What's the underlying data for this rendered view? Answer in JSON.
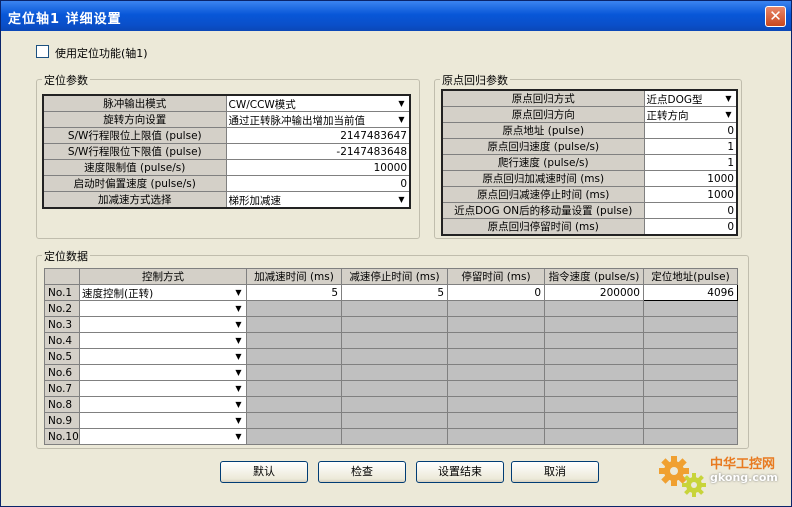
{
  "window": {
    "title": "定位轴1 详细设置",
    "close_label": "✕"
  },
  "enable": {
    "label": "使用定位功能(轴1)",
    "checked": false
  },
  "positioning_params": {
    "title": "定位参数",
    "rows": [
      {
        "label": "脉冲输出模式",
        "type": "select",
        "value": "CW/CCW模式"
      },
      {
        "label": "旋转方向设置",
        "type": "select",
        "value": "通过正转脉冲输出增加当前值"
      },
      {
        "label": "S/W行程限位上限值 (pulse)",
        "type": "number",
        "value": "2147483647"
      },
      {
        "label": "S/W行程限位下限值 (pulse)",
        "type": "number",
        "value": "-2147483648"
      },
      {
        "label": "速度限制值 (pulse/s)",
        "type": "number",
        "value": "10000"
      },
      {
        "label": "启动时偏置速度 (pulse/s)",
        "type": "number",
        "value": "0"
      },
      {
        "label": "加减速方式选择",
        "type": "select",
        "value": "梯形加减速"
      }
    ]
  },
  "origin_params": {
    "title": "原点回归参数",
    "rows": [
      {
        "label": "原点回归方式",
        "type": "select",
        "value": "近点DOG型"
      },
      {
        "label": "原点回归方向",
        "type": "select",
        "value": "正转方向"
      },
      {
        "label": "原点地址 (pulse)",
        "type": "number",
        "value": "0"
      },
      {
        "label": "原点回归速度 (pulse/s)",
        "type": "number",
        "value": "1"
      },
      {
        "label": "爬行速度 (pulse/s)",
        "type": "number",
        "value": "1"
      },
      {
        "label": "原点回归加减速时间 (ms)",
        "type": "number",
        "value": "1000"
      },
      {
        "label": "原点回归减速停止时间 (ms)",
        "type": "number",
        "value": "1000"
      },
      {
        "label": "近点DOG ON后的移动量设置 (pulse)",
        "type": "number",
        "value": "0"
      },
      {
        "label": "原点回归停留时间 (ms)",
        "type": "number",
        "value": "0"
      }
    ]
  },
  "positioning_data": {
    "title": "定位数据",
    "headers": [
      "",
      "控制方式",
      "加减速时间 (ms)",
      "减速停止时间 (ms)",
      "停留时间 (ms)",
      "指令速度 (pulse/s)",
      "定位地址(pulse)"
    ],
    "rows": [
      {
        "no": "No.1",
        "mode": "速度控制(正转)",
        "accel": "5",
        "decel": "5",
        "dwell": "0",
        "speed": "200000",
        "address": "4096"
      },
      {
        "no": "No.2",
        "mode": ""
      },
      {
        "no": "No.3",
        "mode": ""
      },
      {
        "no": "No.4",
        "mode": ""
      },
      {
        "no": "No.5",
        "mode": ""
      },
      {
        "no": "No.6",
        "mode": ""
      },
      {
        "no": "No.7",
        "mode": ""
      },
      {
        "no": "No.8",
        "mode": ""
      },
      {
        "no": "No.9",
        "mode": ""
      },
      {
        "no": "No.10",
        "mode": ""
      }
    ]
  },
  "buttons": {
    "default": "默认",
    "check": "检查",
    "finish": "设置结束",
    "cancel": "取消"
  },
  "watermark": {
    "site_cn": "中华工控网",
    "url": "gkong.com"
  },
  "colors": {
    "title_bar": "#0a4fc9",
    "dialog_bg": "#ece9d8",
    "grid_gray": "#c0c0c0",
    "close_red": "#c9471d"
  }
}
